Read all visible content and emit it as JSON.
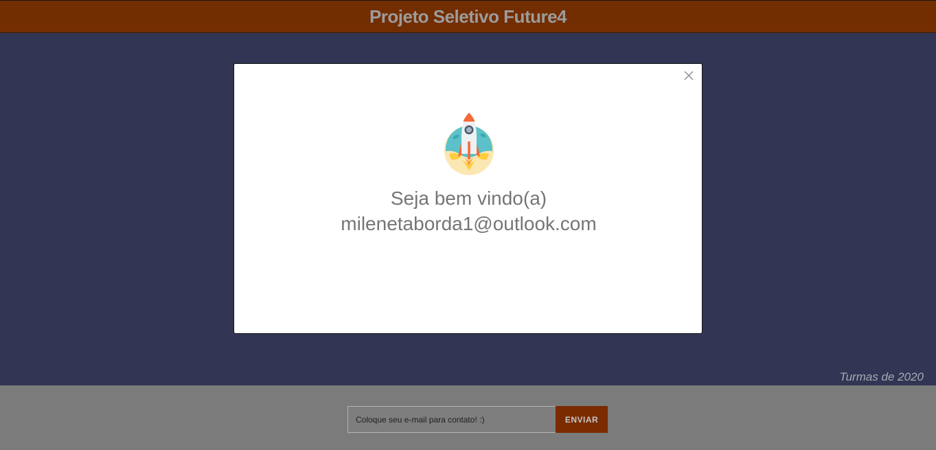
{
  "header": {
    "title": "Projeto Seletivo Future4"
  },
  "main": {
    "footer_tag": "Turmas de 2020"
  },
  "contact": {
    "email_placeholder": "Coloque seu e-mail para contato! :)",
    "send_label": "ENVIAR"
  },
  "modal": {
    "icon": "rocket-icon",
    "close_icon": "close-icon",
    "greeting": "Seja bem vindo(a)",
    "email": "milenetaborda1@outlook.com"
  },
  "colors": {
    "header_bg": "#722d00",
    "main_bg": "#333554",
    "footer_bg": "#7b7b7b",
    "button_bg": "#7a2b00"
  }
}
